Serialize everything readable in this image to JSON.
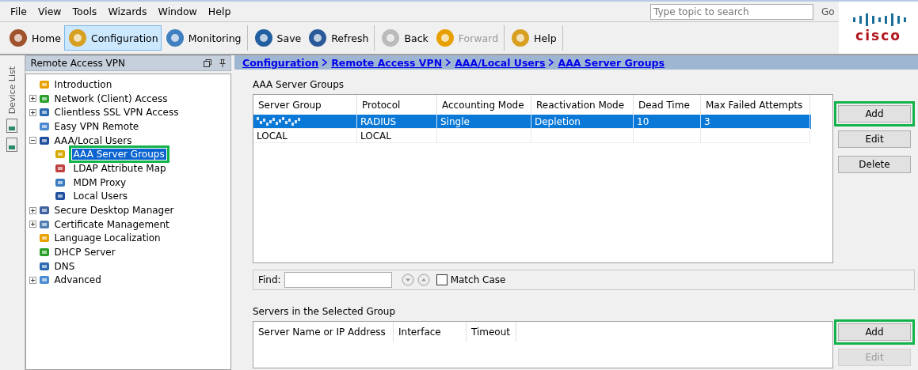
{
  "menu": [
    "File",
    "View",
    "Tools",
    "Wizards",
    "Window",
    "Help"
  ],
  "search": {
    "placeholder": "Type topic to search",
    "button": "Go"
  },
  "logo": {
    "text": "cisco"
  },
  "toolbar": [
    [
      {
        "label": "Home",
        "selected": false,
        "disabled": false
      },
      {
        "label": "Configuration",
        "selected": true,
        "disabled": false
      },
      {
        "label": "Monitoring",
        "selected": false,
        "disabled": false
      }
    ],
    [
      {
        "label": "Save",
        "selected": false,
        "disabled": false
      },
      {
        "label": "Refresh",
        "selected": false,
        "disabled": false
      }
    ],
    [
      {
        "label": "Back",
        "selected": false,
        "disabled": false
      },
      {
        "label": "Forward",
        "selected": false,
        "disabled": true
      }
    ],
    [
      {
        "label": "Help",
        "selected": false,
        "disabled": false
      }
    ]
  ],
  "side_strip": {
    "label": "Device List"
  },
  "nav": {
    "title": "Remote Access VPN",
    "items": [
      {
        "label": "Introduction",
        "selected": false
      },
      {
        "label": "Network (Client) Access",
        "selected": false,
        "expanded": false
      },
      {
        "label": "Clientless SSL VPN Access",
        "selected": false,
        "expanded": false
      },
      {
        "label": "Easy VPN Remote",
        "selected": false
      },
      {
        "label": "AAA/Local Users",
        "selected": false,
        "expanded": true,
        "children": [
          {
            "label": "AAA Server Groups",
            "selected": true,
            "highlighted": true
          },
          {
            "label": "LDAP Attribute Map",
            "selected": false,
            "highlighted": false
          },
          {
            "label": "MDM Proxy",
            "selected": false,
            "highlighted": false
          },
          {
            "label": "Local Users",
            "selected": false,
            "highlighted": false
          }
        ]
      },
      {
        "label": "Secure Desktop Manager",
        "selected": false,
        "expanded": false
      },
      {
        "label": "Certificate Management",
        "selected": false,
        "expanded": false
      },
      {
        "label": "Language Localization",
        "selected": false
      },
      {
        "label": "DHCP Server",
        "selected": false
      },
      {
        "label": "DNS",
        "selected": false
      },
      {
        "label": "Advanced",
        "selected": false,
        "expanded": false
      }
    ]
  },
  "breadcrumb": [
    {
      "label": "Configuration"
    },
    {
      "label": "Remote Access VPN"
    },
    {
      "label": "AAA/Local Users"
    },
    {
      "label": "AAA Server Groups"
    }
  ],
  "server_groups": {
    "title": "AAA Server Groups",
    "columns": [
      "Server Group",
      "Protocol",
      "Accounting Mode",
      "Reactivation Mode",
      "Dead Time",
      "Max Failed Attempts"
    ],
    "rows": [
      {
        "selected": true,
        "cells": [
          {
            "obscured": true
          },
          {
            "text": "RADIUS"
          },
          {
            "text": "Single"
          },
          {
            "text": "Depletion"
          },
          {
            "text": "10"
          },
          {
            "text": "3"
          }
        ]
      },
      {
        "selected": false,
        "cells": [
          {
            "text": "LOCAL"
          },
          {
            "text": "LOCAL"
          }
        ]
      }
    ],
    "buttons": [
      {
        "label": "Add",
        "highlighted": true,
        "disabled": false
      },
      {
        "label": "Edit",
        "highlighted": false,
        "disabled": false
      },
      {
        "label": "Delete",
        "highlighted": false,
        "disabled": false
      }
    ]
  },
  "find": {
    "label": "Find:",
    "match_case": {
      "label": "Match Case",
      "checked": false
    }
  },
  "servers": {
    "title": "Servers in the Selected Group",
    "columns": [
      "Server Name or IP Address",
      "Interface",
      "Timeout"
    ],
    "buttons": [
      {
        "label": "Add",
        "highlighted": true,
        "disabled": false
      },
      {
        "label": "Edit",
        "highlighted": false,
        "disabled": true
      }
    ]
  }
}
